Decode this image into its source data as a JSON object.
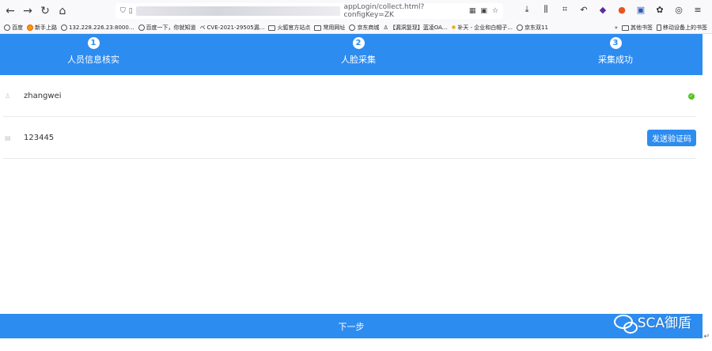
{
  "browser": {
    "url_text": "appLogin/collect.html?configKey=ZK",
    "bookmarks": [
      "百度",
      "新手上路",
      "132.228.226.23:8000...",
      "百度一下，你就知道",
      "CVE-2021-29505漏...",
      "火狐官方站点",
      "常用网址",
      "京东商城",
      "【漏洞复现】蓝凌OA...",
      "补天 - 企业和白帽子...",
      "京东双11"
    ],
    "other_bookmarks": "其他书签",
    "mobile_bookmarks": "移动设备上的书签"
  },
  "steps": [
    {
      "number": "1",
      "label": "人员信息核实"
    },
    {
      "number": "2",
      "label": "人脸采集"
    },
    {
      "number": "3",
      "label": "采集成功"
    }
  ],
  "form": {
    "username": "zhangwei",
    "code_value": "123445",
    "send_code_label": "发送验证码"
  },
  "next_label": "下一步",
  "watermark": "SCA御盾",
  "colors": {
    "accent": "#2d8cf0",
    "success": "#52c41a"
  }
}
